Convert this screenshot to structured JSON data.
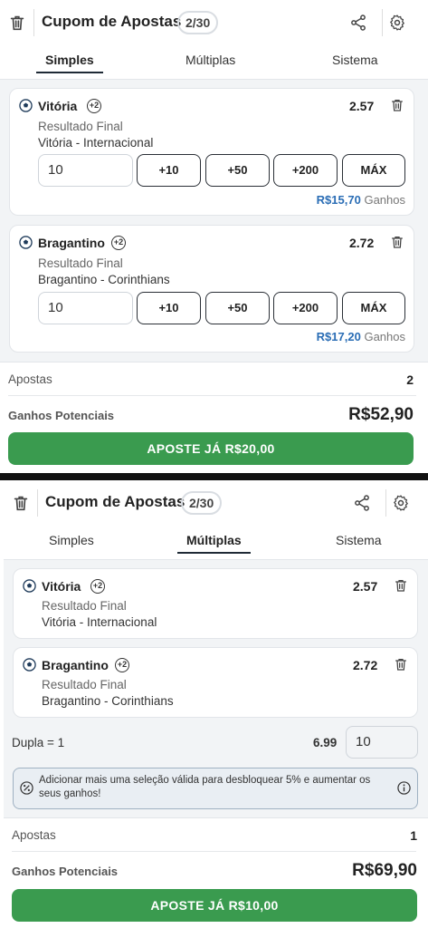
{
  "header": {
    "title": "Cupom de Apostas",
    "count": "2/30"
  },
  "tabs": [
    "Simples",
    "Múltiplas",
    "Sistema"
  ],
  "screen1": {
    "active_tab": "Simples",
    "selections": [
      {
        "team": "Vitória",
        "badge": "+2",
        "odd": "2.57",
        "market": "Resultado Final",
        "match": "Vitória - Internacional",
        "stake": "10",
        "quick": [
          "+10",
          "+50",
          "+200",
          "MÁX"
        ],
        "winnings": "R$15,70",
        "winnings_label": "Ganhos"
      },
      {
        "team": "Bragantino",
        "badge": "+2",
        "odd": "2.72",
        "market": "Resultado Final",
        "match": "Bragantino - Corinthians",
        "stake": "10",
        "quick": [
          "+10",
          "+50",
          "+200",
          "MÁX"
        ],
        "winnings": "R$17,20",
        "winnings_label": "Ganhos"
      }
    ],
    "summary": {
      "bets_label": "Apostas",
      "bets_value": "2",
      "potential_label": "Ganhos Potenciais",
      "potential_value": "R$52,90",
      "button": "APOSTE JÁ R$20,00"
    }
  },
  "screen2": {
    "active_tab": "Múltiplas",
    "selections": [
      {
        "team": "Vitória",
        "badge": "+2",
        "odd": "2.57",
        "market": "Resultado Final",
        "match": "Vitória - Internacional"
      },
      {
        "team": "Bragantino",
        "badge": "+2",
        "odd": "2.72",
        "market": "Resultado Final",
        "match": "Bragantino - Corinthians"
      }
    ],
    "dupla_label": "Dupla = 1",
    "dupla_odd": "6.99",
    "dupla_stake": "10",
    "info": "Adicionar mais uma seleção válida para desbloquear 5% e aumentar os seus ganhos!",
    "summary": {
      "bets_label": "Apostas",
      "bets_value": "1",
      "potential_label": "Ganhos Potenciais",
      "potential_value": "R$69,90",
      "button": "APOSTE JÁ R$10,00"
    }
  },
  "colors": {
    "accent_green": "#3a9b4f",
    "winnings_blue": "#2a6db5"
  },
  "icons": [
    "trash-icon",
    "share-icon",
    "gear-icon",
    "soccer-ball-icon",
    "info-icon",
    "percent-icon"
  ]
}
